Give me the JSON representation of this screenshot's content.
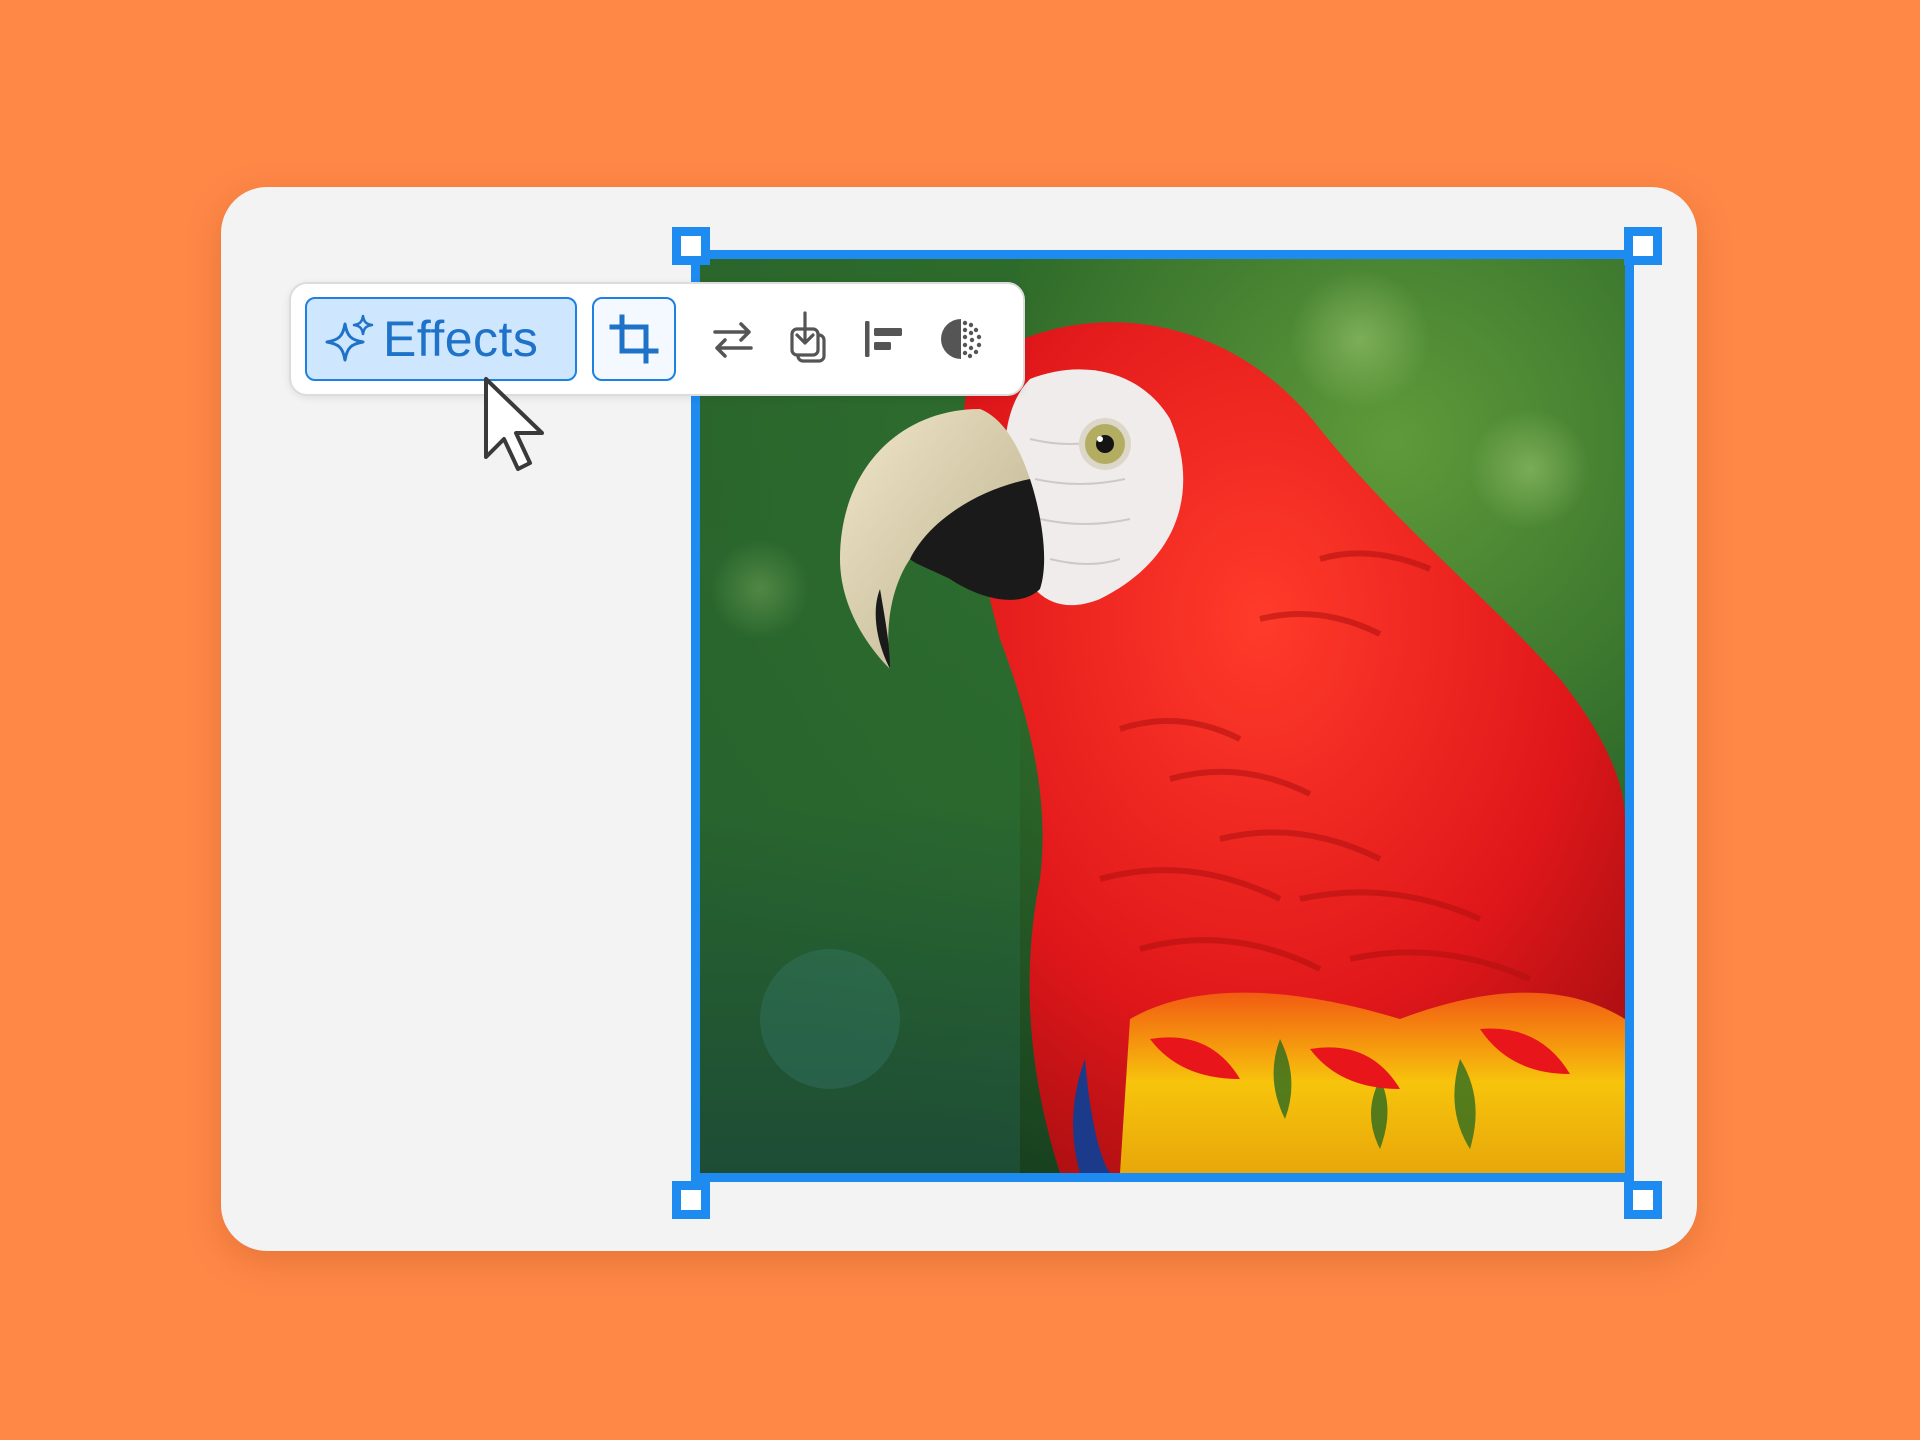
{
  "toolbar": {
    "effects_label": "Effects",
    "active_tool": "crop"
  },
  "colors": {
    "background": "#FF8847",
    "selection": "#1E8BF0",
    "effects_fill": "#CFE6FF",
    "effects_text": "#1E72C8"
  },
  "icons": [
    "sparkle-icon",
    "crop-icon",
    "swap-icon",
    "download-layer-icon",
    "align-left-icon",
    "contrast-icon",
    "pointer-cursor-icon"
  ]
}
